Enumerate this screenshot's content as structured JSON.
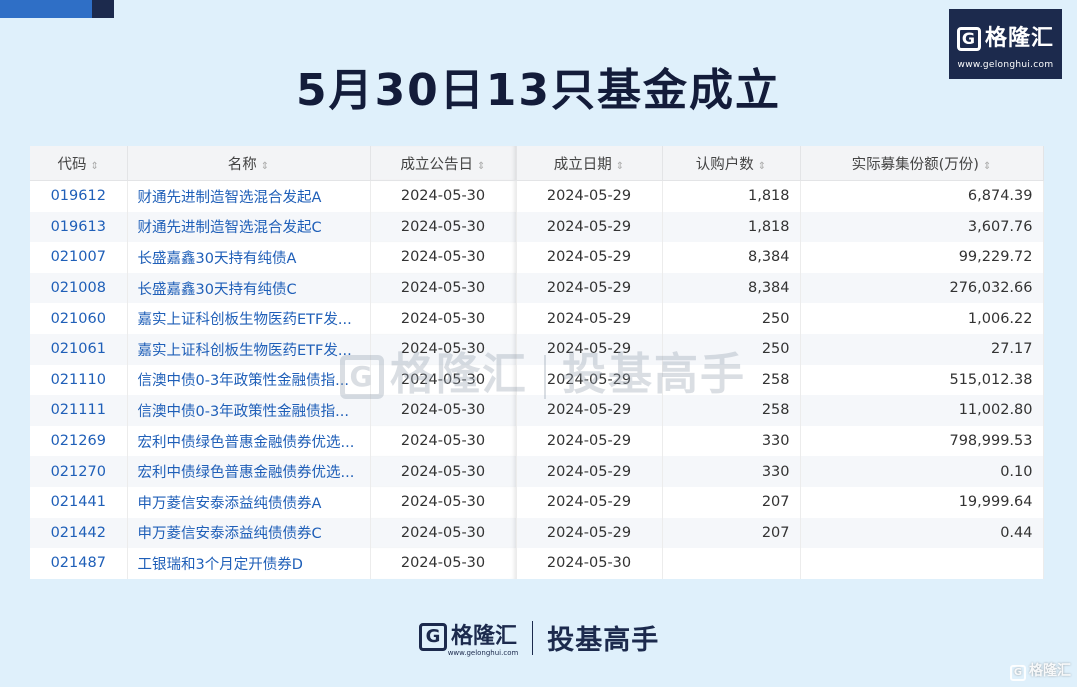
{
  "brand": {
    "logo_text": "格隆汇",
    "logo_letter": "G",
    "url": "www.gelonghui.com",
    "slogan": "投基高手"
  },
  "title": "5月30日13只基金成立",
  "table": {
    "headers": [
      "代码",
      "名称",
      "成立公告日",
      "成立日期",
      "认购户数",
      "实际募集份额(万份)"
    ],
    "sort_icon": "sort-icon",
    "rows": [
      {
        "code": "019612",
        "name": "财通先进制造智选混合发起A",
        "announce": "2024-05-30",
        "date": "2024-05-29",
        "subscribers": "1,818",
        "shares": "6,874.39"
      },
      {
        "code": "019613",
        "name": "财通先进制造智选混合发起C",
        "announce": "2024-05-30",
        "date": "2024-05-29",
        "subscribers": "1,818",
        "shares": "3,607.76"
      },
      {
        "code": "021007",
        "name": "长盛嘉鑫30天持有纯债A",
        "announce": "2024-05-30",
        "date": "2024-05-29",
        "subscribers": "8,384",
        "shares": "99,229.72"
      },
      {
        "code": "021008",
        "name": "长盛嘉鑫30天持有纯债C",
        "announce": "2024-05-30",
        "date": "2024-05-29",
        "subscribers": "8,384",
        "shares": "276,032.66"
      },
      {
        "code": "021060",
        "name": "嘉实上证科创板生物医药ETF发...",
        "announce": "2024-05-30",
        "date": "2024-05-29",
        "subscribers": "250",
        "shares": "1,006.22"
      },
      {
        "code": "021061",
        "name": "嘉实上证科创板生物医药ETF发...",
        "announce": "2024-05-30",
        "date": "2024-05-29",
        "subscribers": "250",
        "shares": "27.17"
      },
      {
        "code": "021110",
        "name": "信澳中债0-3年政策性金融债指...",
        "announce": "2024-05-30",
        "date": "2024-05-29",
        "subscribers": "258",
        "shares": "515,012.38"
      },
      {
        "code": "021111",
        "name": "信澳中债0-3年政策性金融债指...",
        "announce": "2024-05-30",
        "date": "2024-05-29",
        "subscribers": "258",
        "shares": "11,002.80"
      },
      {
        "code": "021269",
        "name": "宏利中债绿色普惠金融债券优选...",
        "announce": "2024-05-30",
        "date": "2024-05-29",
        "subscribers": "330",
        "shares": "798,999.53"
      },
      {
        "code": "021270",
        "name": "宏利中债绿色普惠金融债券优选...",
        "announce": "2024-05-30",
        "date": "2024-05-29",
        "subscribers": "330",
        "shares": "0.10"
      },
      {
        "code": "021441",
        "name": "申万菱信安泰添益纯债债券A",
        "announce": "2024-05-30",
        "date": "2024-05-29",
        "subscribers": "207",
        "shares": "19,999.64"
      },
      {
        "code": "021442",
        "name": "申万菱信安泰添益纯债债券C",
        "announce": "2024-05-30",
        "date": "2024-05-29",
        "subscribers": "207",
        "shares": "0.44"
      },
      {
        "code": "021487",
        "name": "工银瑞和3个月定开债券D",
        "announce": "2024-05-30",
        "date": "2024-05-30",
        "subscribers": "",
        "shares": ""
      }
    ]
  },
  "colors": {
    "background": "#dff0fb",
    "title": "#131c3a",
    "link": "#1f5fb8",
    "brand_dark": "#1c2a4d"
  }
}
